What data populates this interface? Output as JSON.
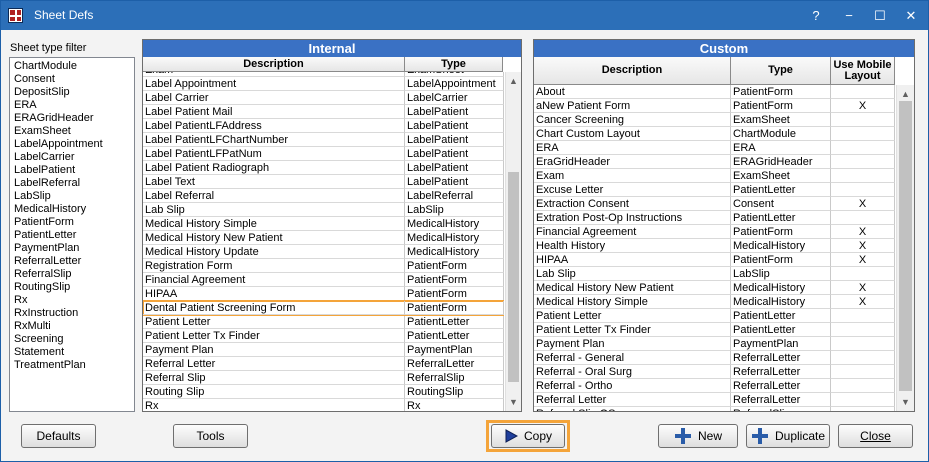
{
  "window": {
    "title": "Sheet Defs",
    "help_label": "?",
    "minimize_label": "−",
    "maximize_label": "☐",
    "close_label": "✕"
  },
  "filter": {
    "label": "Sheet type filter",
    "items": [
      "ChartModule",
      "Consent",
      "DepositSlip",
      "ERA",
      "ERAGridHeader",
      "ExamSheet",
      "LabelAppointment",
      "LabelCarrier",
      "LabelPatient",
      "LabelReferral",
      "LabSlip",
      "MedicalHistory",
      "PatientForm",
      "PatientLetter",
      "PaymentPlan",
      "ReferralLetter",
      "ReferralSlip",
      "RoutingSlip",
      "Rx",
      "RxInstruction",
      "RxMulti",
      "Screening",
      "Statement",
      "TreatmentPlan"
    ]
  },
  "internal": {
    "title": "Internal",
    "columns": [
      "Description",
      "Type"
    ],
    "partial_top": [
      "Exam",
      "ExamSheet"
    ],
    "rows": [
      [
        "Label Appointment",
        "LabelAppointment"
      ],
      [
        "Label Carrier",
        "LabelCarrier"
      ],
      [
        "Label Patient Mail",
        "LabelPatient"
      ],
      [
        "Label PatientLFAddress",
        "LabelPatient"
      ],
      [
        "Label PatientLFChartNumber",
        "LabelPatient"
      ],
      [
        "Label PatientLFPatNum",
        "LabelPatient"
      ],
      [
        "Label Patient Radiograph",
        "LabelPatient"
      ],
      [
        "Label Text",
        "LabelPatient"
      ],
      [
        "Label Referral",
        "LabelReferral"
      ],
      [
        "Lab Slip",
        "LabSlip"
      ],
      [
        "Medical History Simple",
        "MedicalHistory"
      ],
      [
        "Medical History New Patient",
        "MedicalHistory"
      ],
      [
        "Medical History Update",
        "MedicalHistory"
      ],
      [
        "Registration Form",
        "PatientForm"
      ],
      [
        "Financial Agreement",
        "PatientForm"
      ],
      [
        "HIPAA",
        "PatientForm"
      ],
      [
        "Dental Patient Screening Form",
        "PatientForm"
      ],
      [
        "Patient Letter",
        "PatientLetter"
      ],
      [
        "Patient Letter Tx Finder",
        "PatientLetter"
      ],
      [
        "Payment Plan",
        "PaymentPlan"
      ],
      [
        "Referral Letter",
        "ReferralLetter"
      ],
      [
        "Referral Slip",
        "ReferralSlip"
      ],
      [
        "Routing Slip",
        "RoutingSlip"
      ],
      [
        "Rx",
        "Rx"
      ]
    ],
    "selected_row": "Dental Patient Screening Form"
  },
  "custom": {
    "title": "Custom",
    "columns": [
      "Description",
      "Type",
      "Use Mobile Layout"
    ],
    "rows": [
      [
        "About",
        "PatientForm",
        ""
      ],
      [
        "aNew Patient Form",
        "PatientForm",
        "X"
      ],
      [
        "Cancer Screening",
        "ExamSheet",
        ""
      ],
      [
        "Chart Custom Layout",
        "ChartModule",
        ""
      ],
      [
        "ERA",
        "ERA",
        ""
      ],
      [
        "EraGridHeader",
        "ERAGridHeader",
        ""
      ],
      [
        "Exam",
        "ExamSheet",
        ""
      ],
      [
        "Excuse Letter",
        "PatientLetter",
        ""
      ],
      [
        "Extraction Consent",
        "Consent",
        "X"
      ],
      [
        "Extration Post-Op Instructions",
        "PatientLetter",
        ""
      ],
      [
        "Financial Agreement",
        "PatientForm",
        "X"
      ],
      [
        "Health History",
        "MedicalHistory",
        "X"
      ],
      [
        "HIPAA",
        "PatientForm",
        "X"
      ],
      [
        "Lab Slip",
        "LabSlip",
        ""
      ],
      [
        "Medical History New Patient",
        "MedicalHistory",
        "X"
      ],
      [
        "Medical History Simple",
        "MedicalHistory",
        "X"
      ],
      [
        "Patient Letter",
        "PatientLetter",
        ""
      ],
      [
        "Patient Letter Tx Finder",
        "PatientLetter",
        ""
      ],
      [
        "Payment Plan",
        "PaymentPlan",
        ""
      ],
      [
        "Referral - General",
        "ReferralLetter",
        ""
      ],
      [
        "Referral - Oral Surg",
        "ReferralLetter",
        ""
      ],
      [
        "Referral - Ortho",
        "ReferralLetter",
        ""
      ],
      [
        "Referral Letter",
        "ReferralLetter",
        ""
      ]
    ],
    "partial_bottom": [
      "Referral Slip OS",
      "ReferralSlip",
      ""
    ]
  },
  "buttons": {
    "defaults": "Defaults",
    "tools": "Tools",
    "copy": "Copy",
    "new": "New",
    "duplicate": "Duplicate",
    "close": "Close"
  },
  "colors": {
    "titlebar": "#2c6fb8",
    "grid_header": "#3a71c4",
    "highlight": "#f4a43a",
    "plus_icon": "#2a5ca8"
  },
  "icons": {
    "copy": "play-arrow-icon",
    "new": "plus-icon",
    "duplicate": "plus-icon"
  }
}
